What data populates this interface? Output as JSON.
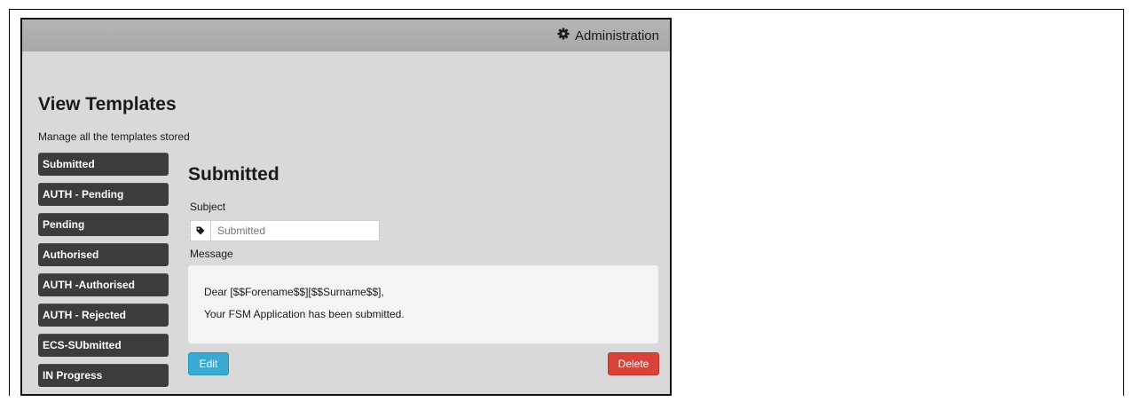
{
  "header": {
    "admin_label": "Administration",
    "admin_icon": "gear-icon"
  },
  "page": {
    "title": "View Templates",
    "subtitle": "Manage all the templates stored"
  },
  "sidebar": {
    "items": [
      {
        "label": "Submitted"
      },
      {
        "label": "AUTH - Pending"
      },
      {
        "label": "Pending"
      },
      {
        "label": "Authorised"
      },
      {
        "label": "AUTH -Authorised"
      },
      {
        "label": "AUTH - Rejected"
      },
      {
        "label": "ECS-SUbmitted"
      },
      {
        "label": "IN Progress"
      }
    ]
  },
  "detail": {
    "title": "Submitted",
    "subject_label": "Subject",
    "subject_icon": "tag-icon",
    "subject_placeholder": "Submitted",
    "message_label": "Message",
    "message_lines": [
      "Dear [$$Forename$$][$$Surname$$],",
      "Your FSM Application has been submitted."
    ],
    "edit_label": "Edit",
    "delete_label": "Delete"
  },
  "colors": {
    "sidebar_item_bg": "#3c3c3c",
    "edit_button": "#3aaad3",
    "delete_button": "#d9423a",
    "panel_bg": "#d9d9d9",
    "top_bar": "#adadad"
  }
}
